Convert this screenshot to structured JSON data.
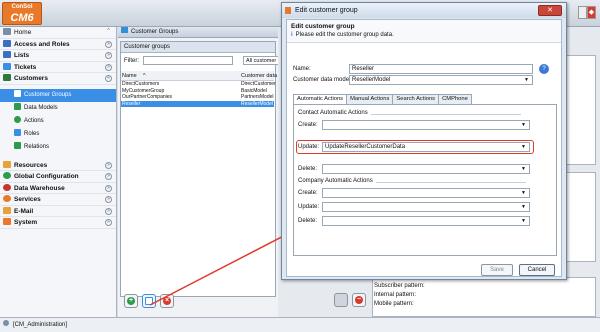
{
  "app": {
    "logo_top": "ConSol",
    "logo_bottom": "CM6"
  },
  "sidebar": {
    "items": [
      {
        "label": "Home",
        "icon": "home-icon",
        "color": "#7a8ea6"
      },
      {
        "label": "Access and Roles",
        "icon": "access-icon",
        "color": "#3a6fc4"
      },
      {
        "label": "Lists",
        "icon": "list-icon",
        "color": "#3a6fc4"
      },
      {
        "label": "Tickets",
        "icon": "ticket-icon",
        "color": "#3a8ee6"
      },
      {
        "label": "Customers",
        "icon": "customers-icon",
        "color": "#2f7a3a"
      }
    ],
    "sub_items": [
      {
        "label": "Customer Groups",
        "color": "#2f8fd8"
      },
      {
        "label": "Data Models",
        "color": "#2e9b4a"
      },
      {
        "label": "Actions",
        "color": "#2e9b4a"
      },
      {
        "label": "Roles",
        "color": "#3a8ee6"
      },
      {
        "label": "Relations",
        "color": "#2e9b4a"
      }
    ],
    "items2": [
      {
        "label": "Resources",
        "color": "#e8a23a"
      },
      {
        "label": "Global Configuration",
        "color": "#2e9b4a"
      },
      {
        "label": "Data Warehouse",
        "color": "#c0392b"
      },
      {
        "label": "Services",
        "color": "#e8792b"
      },
      {
        "label": "E-Mail",
        "color": "#e8a23a"
      },
      {
        "label": "System",
        "color": "#e8792b"
      }
    ]
  },
  "main": {
    "panel_title": "Customer Groups",
    "box_title": "Customer groups",
    "filter_label": "Filter:",
    "filter_dropdown": "All customer",
    "col_name": "Name",
    "col_model": "Customer data",
    "rows": [
      {
        "name": "DirectCustomers",
        "model": "DirectCustomer"
      },
      {
        "name": "MyCustomerGroup",
        "model": "BasicModel"
      },
      {
        "name": "OurPartnerCompanies",
        "model": "PartnersModel"
      },
      {
        "name": "Reseller",
        "model": "ResellerModel"
      }
    ]
  },
  "dialog": {
    "title": "Edit customer group",
    "header_title": "Edit customer group",
    "header_info": "Please edit the customer group data.",
    "name_label": "Name:",
    "name_value": "Reseller",
    "model_label": "Customer data model:",
    "model_value": "ResellerModel",
    "tabs": [
      "Automatic Actions",
      "Manual Actions",
      "Search Actions",
      "CMPhone"
    ],
    "contact_group": "Contact Automatic Actions",
    "company_group": "Company Automatic Actions",
    "create_label": "Create:",
    "update_label": "Update:",
    "delete_label": "Delete:",
    "contact_update_value": "UpdateResellerCustomerData",
    "save": "Save",
    "cancel": "Cancel"
  },
  "right_panel": {
    "labels": [
      "Subscriber pattern:",
      "Internal pattern:",
      "Mobile pattern:"
    ]
  },
  "status": {
    "user": "[CM_Administration]"
  },
  "colors": {
    "accent": "#3a8ee6",
    "highlight": "#e23a2a",
    "logo": "#e8792b"
  }
}
